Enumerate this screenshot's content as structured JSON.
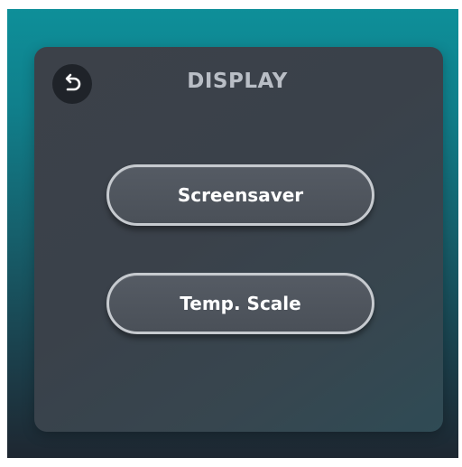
{
  "header": {
    "title": "DISPLAY",
    "back_icon": "back-arrow-icon"
  },
  "menu": {
    "items": [
      {
        "label": "Screensaver"
      },
      {
        "label": "Temp. Scale"
      }
    ]
  },
  "colors": {
    "background_top": "#0e8f99",
    "background_bottom": "#1e2731",
    "panel": "#3c4149",
    "button_border": "#c6cacf",
    "button_fill": "#50565e",
    "title_text": "#b9bec6",
    "button_text": "#ffffff"
  }
}
